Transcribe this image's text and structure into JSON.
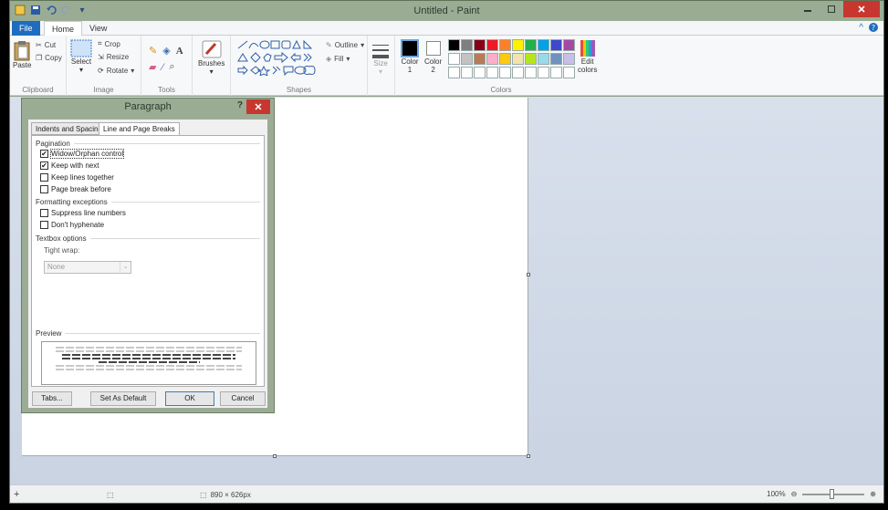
{
  "window": {
    "title": "Untitled - Paint"
  },
  "qat": {
    "icons": [
      "paint-app-icon",
      "save-icon",
      "undo-icon",
      "redo-icon",
      "customize-qat-icon"
    ]
  },
  "tabs": [
    {
      "label": "File"
    },
    {
      "label": "Home"
    },
    {
      "label": "View"
    }
  ],
  "ribbon": {
    "clipboard": {
      "paste": "Paste",
      "cut": "Cut",
      "copy": "Copy",
      "group": "Clipboard"
    },
    "image": {
      "select": "Select",
      "crop": "Crop",
      "resize": "Resize",
      "rotate": "Rotate",
      "group": "Image"
    },
    "tools": {
      "group": "Tools"
    },
    "brushes": {
      "label": "Brushes"
    },
    "shapes": {
      "outline": "Outline",
      "fill": "Fill",
      "group": "Shapes"
    },
    "size": {
      "label": "Size"
    },
    "colors": {
      "color1": "Color",
      "color1_num": "1",
      "color2": "Color",
      "color2_num": "2",
      "edit": "Edit",
      "edit2": "colors",
      "group": "Colors",
      "palette_row1": [
        "#000000",
        "#7f7f7f",
        "#880015",
        "#ed1c24",
        "#ff7f27",
        "#fff200",
        "#22b14c",
        "#00a2e8",
        "#3f48cc",
        "#a349a4"
      ],
      "palette_row2": [
        "#ffffff",
        "#c3c3c3",
        "#b97a57",
        "#ffaec9",
        "#ffc90e",
        "#efe4b0",
        "#b5e61d",
        "#99d9ea",
        "#7092be",
        "#c8bfe7"
      ],
      "primary": "#000000",
      "secondary": "#ffffff"
    }
  },
  "dialog": {
    "title": "Paragraph",
    "help": "?",
    "tab1": "Indents and Spacing",
    "tab2": "Line and Page Breaks",
    "pagination": "Pagination",
    "widow": "Widow/Orphan control",
    "widow_checked": true,
    "keep_next": "Keep with next",
    "keep_next_checked": true,
    "keep_lines": "Keep lines together",
    "keep_lines_checked": false,
    "page_break": "Page break before",
    "page_break_checked": false,
    "formatting": "Formatting exceptions",
    "suppress": "Suppress line numbers",
    "suppress_checked": false,
    "hyphenate": "Don't hyphenate",
    "hyphenate_checked": false,
    "textbox": "Textbox options",
    "tight_wrap": "Tight wrap:",
    "tight_value": "None",
    "preview": "Preview",
    "tabs_btn": "Tabs...",
    "default_btn": "Set As Default",
    "ok_btn": "OK",
    "cancel_btn": "Cancel"
  },
  "status": {
    "size": "890 × 626px",
    "zoom": "100%"
  }
}
